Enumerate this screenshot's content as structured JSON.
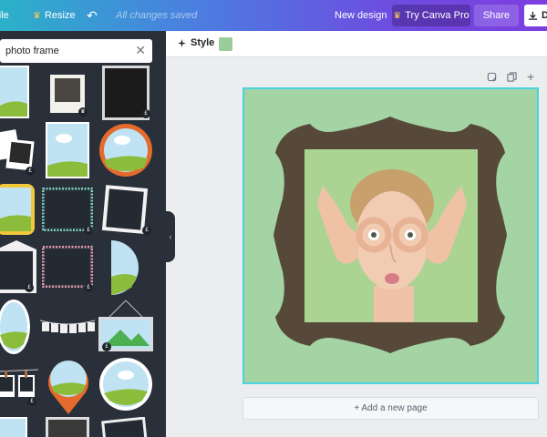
{
  "topbar": {
    "file_label": "File",
    "resize_label": "Resize",
    "saved_status": "All changes saved",
    "new_design_label": "New design",
    "try_pro_label": "Try Canva Pro",
    "share_label": "Share",
    "download_label": "D"
  },
  "search": {
    "value": "photo frame"
  },
  "stylebar": {
    "style_label": "Style",
    "background_color": "#9bcd9b"
  },
  "canvas": {
    "page_color": "#a4d3a4",
    "frame_color": "#57493a",
    "add_page_label": "+ Add a new page"
  },
  "icons": [
    "crown-icon",
    "undo-icon",
    "download-icon",
    "close-icon",
    "style-icon",
    "notes-icon",
    "duplicate-icon",
    "add-page-icon",
    "chevron-left-icon"
  ]
}
